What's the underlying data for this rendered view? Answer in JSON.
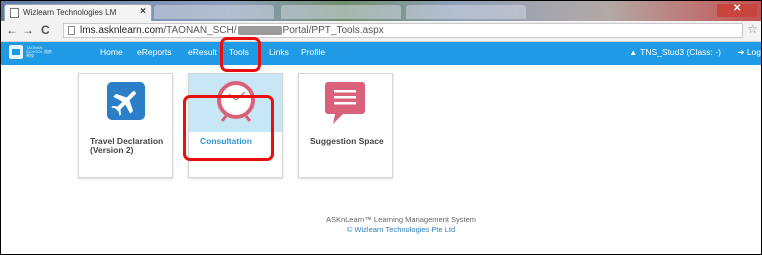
{
  "browser": {
    "tab_title": "Wizlearn Technologies LM",
    "tab_close": "×",
    "url_host": "lms.asknlearn.com",
    "url_path_1": "/TAONAN_SCH/",
    "url_path_2": "Portal/PPT_Tools.aspx",
    "back_icon": "←",
    "forward_icon": "→",
    "reload_icon": "C",
    "star_icon": "☆"
  },
  "navbar": {
    "logo_text": "TAONAN SCHOOL 道南學校",
    "items": [
      "Home",
      "eReports",
      "eResult",
      "Tools",
      "Links",
      "Profile"
    ],
    "user_label": "TNS_Stud3 (Class: -)",
    "logout_label": "Log"
  },
  "cards": [
    {
      "label": "Travel Declaration (Version 2)",
      "icon": "airplane-icon"
    },
    {
      "label": "Consultation",
      "icon": "clock-icon"
    },
    {
      "label": "Suggestion Space",
      "icon": "speech-bubble-icon"
    }
  ],
  "footer": {
    "line1": "ASKnLearn™ Learning Management System",
    "line2": "© Wizlearn Technologies Pte Ltd"
  },
  "colors": {
    "navbar": "#1f9ae4",
    "highlight": "#e8100f",
    "travel_tile": "#2a7fc8",
    "consultation_tile": "#c7e6f6",
    "suggestion_tile": "#d9627a"
  }
}
